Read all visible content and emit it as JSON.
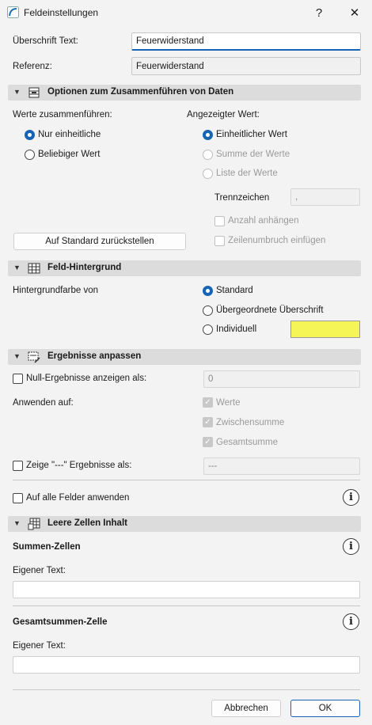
{
  "window": {
    "title": "Feldeinstellungen",
    "help": "?",
    "close": "✕"
  },
  "header": {
    "caption_label": "Überschrift Text:",
    "caption_value": "Feuerwiderstand",
    "reference_label": "Referenz:",
    "reference_value": "Feuerwiderstand"
  },
  "merge": {
    "section_title": "Optionen zum Zusammenführen von Daten",
    "merge_label": "Werte zusammenführen:",
    "opt_unique": "Nur einheitliche",
    "opt_any": "Beliebiger Wert",
    "shown_label": "Angezeigter Wert:",
    "shown_unique": "Einheitlicher Wert",
    "shown_sum": "Summe der Werte",
    "shown_list": "Liste der Werte",
    "separator_label": "Trennzeichen",
    "separator_value": ",",
    "append_count": "Anzahl anhängen",
    "line_break": "Zeilenumbruch einfügen",
    "reset_button": "Auf Standard zurückstellen"
  },
  "background": {
    "section_title": "Feld-Hintergrund",
    "label": "Hintergrundfarbe von",
    "opt_default": "Standard",
    "opt_parent": "Übergeordnete Überschrift",
    "opt_custom": "Individuell",
    "swatch_color": "#f5f557"
  },
  "results": {
    "section_title": "Ergebnisse anpassen",
    "null_label": "Null-Ergebnisse anzeigen als:",
    "null_value": "0",
    "apply_label": "Anwenden auf:",
    "apply_values": "Werte",
    "apply_subtotal": "Zwischensumme",
    "apply_total": "Gesamtsumme",
    "dash_label": "Zeige \"---\" Ergebnisse als:",
    "dash_value": "---",
    "apply_all": "Auf alle Felder anwenden"
  },
  "empty": {
    "section_title": "Leere Zellen Inhalt",
    "sum_cells": "Summen-Zellen",
    "own_text_1": "Eigener Text:",
    "total_cell": "Gesamtsummen-Zelle",
    "own_text_2": "Eigener Text:"
  },
  "footer": {
    "cancel": "Abbrechen",
    "ok": "OK"
  },
  "info_glyph": "i"
}
